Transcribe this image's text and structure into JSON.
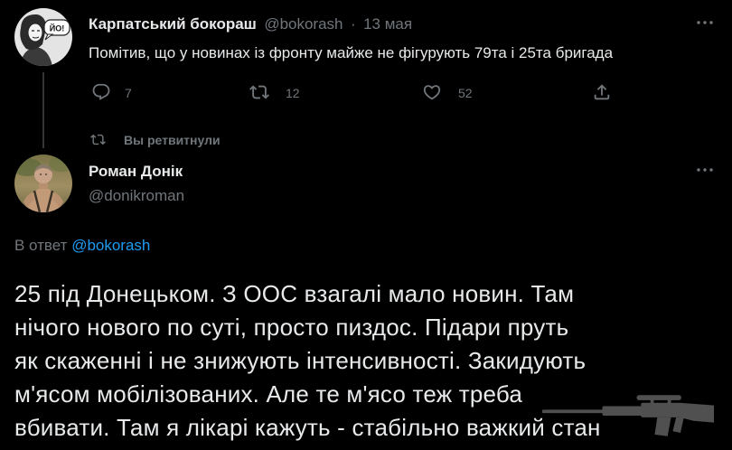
{
  "colors": {
    "background": "#000000",
    "text": "#e7e9ea",
    "muted": "#71767b",
    "link": "#1d9bf0",
    "line": "#333639"
  },
  "parent_tweet": {
    "avatar_bubble": "ЙО!",
    "name": "Карпатський бокораш",
    "handle": "@bokorash",
    "separator": "·",
    "time": "13 мая",
    "more_icon": "more-icon",
    "text": "Помітив, що у новинах із фронту майже не фігурують 79та і 25та бригада",
    "actions": [
      {
        "icon": "reply-icon",
        "count": "7"
      },
      {
        "icon": "retweet-icon",
        "count": "12"
      },
      {
        "icon": "heart-icon",
        "count": "52"
      },
      {
        "icon": "share-icon"
      }
    ]
  },
  "social_context": {
    "icon": "retweet-icon",
    "text": "Вы ретвитнули"
  },
  "main_tweet": {
    "name": "Роман Донік",
    "handle": "@donikroman",
    "more_icon": "more-icon",
    "reply_prefix": "В ответ",
    "reply_to": "@bokorash",
    "text_lines": [
      "25 під Донецьком. З ООС взагалі мало новин. Там",
      "нічого нового по суті, просто пиздос. Підари пруть",
      "як скаженні і не знижують інтенсивності. Закидують",
      "м'ясом мобілізованих. Але те м'ясо теж треба",
      "вбивати. Там я лікарі кажуть - стабільно важкий стан"
    ]
  }
}
